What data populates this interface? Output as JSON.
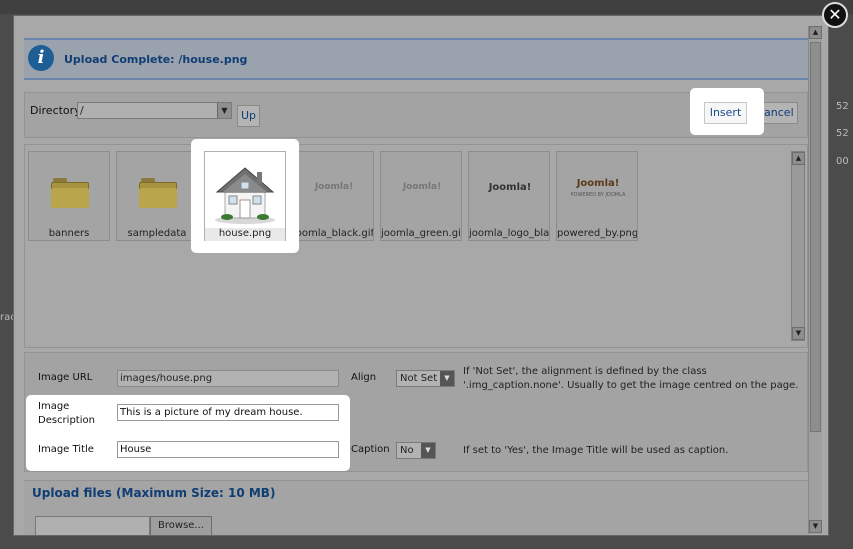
{
  "dialog": {
    "message": "Upload Complete: /house.png",
    "close_label": "✕"
  },
  "toolbar": {
    "directory_label": "Directory",
    "directory_value": "/",
    "up_label": "Up",
    "insert_label": "Insert",
    "cancel_label": "Cancel"
  },
  "files": [
    {
      "name": "banners",
      "type": "folder"
    },
    {
      "name": "sampledata",
      "type": "folder"
    },
    {
      "name": "house.png",
      "type": "image"
    },
    {
      "name": "joomla_black.gif",
      "type": "image"
    },
    {
      "name": "joomla_green.gif",
      "type": "image"
    },
    {
      "name": "joomla_logo_black.jpg",
      "type": "image"
    },
    {
      "name": "powered_by.png",
      "type": "image"
    }
  ],
  "logos": {
    "joomla_black": "Joomla!",
    "joomla_green": "Joomla!",
    "joomla_logo": "Joomla!",
    "powered_by": "Joomla!",
    "powered_by_sub": "POWERED BY JOOMLA"
  },
  "properties": {
    "image_url_label": "Image URL",
    "image_url_value": "images/house.png",
    "align_label": "Align",
    "align_value": "Not Set",
    "align_note": "If 'Not Set', the alignment is defined by the class '.img_caption.none'. Usually to get the image centred on the page.",
    "description_label": "Image Description",
    "description_value": "This is a picture of my dream house.",
    "title_label": "Image Title",
    "title_value": "House",
    "caption_label": "Caption",
    "caption_value": "No",
    "caption_note": "If set to 'Yes', the Image Title will be used as caption."
  },
  "upload": {
    "title": "Upload files (Maximum Size: 10 MB)",
    "browse_label": "Browse..."
  },
  "background": {
    "numbers": [
      "52",
      "52",
      "00"
    ],
    "side_text": "rac"
  },
  "colors": {
    "message_text": "#0f3d74",
    "info_icon": "#1f5e94",
    "highlight": "#ffffff"
  }
}
